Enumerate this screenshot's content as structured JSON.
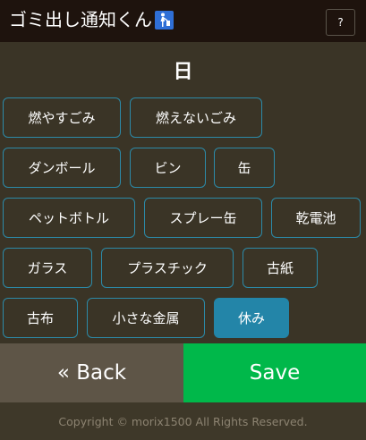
{
  "header": {
    "app_title": "ゴミ出し通知くん",
    "help_label": "?"
  },
  "day": {
    "title": "日"
  },
  "categories": [
    {
      "label": "燃やすごみ",
      "selected": false
    },
    {
      "label": "燃えないごみ",
      "selected": false
    },
    {
      "label": "ダンボール",
      "selected": false
    },
    {
      "label": "ビン",
      "selected": false
    },
    {
      "label": "缶",
      "selected": false
    },
    {
      "label": "ペットボトル",
      "selected": false
    },
    {
      "label": "スプレー缶",
      "selected": false
    },
    {
      "label": "乾電池",
      "selected": false
    },
    {
      "label": "ガラス",
      "selected": false
    },
    {
      "label": "プラスチック",
      "selected": false
    },
    {
      "label": "古紙",
      "selected": false
    },
    {
      "label": "古布",
      "selected": false
    },
    {
      "label": "小さな金属",
      "selected": false
    },
    {
      "label": "休み",
      "selected": true
    }
  ],
  "actions": {
    "back_label": "« Back",
    "save_label": "Save"
  },
  "footer": {
    "copyright": "Copyright © morix1500 All Rights Reserved."
  },
  "colors": {
    "background": "#3a3426",
    "header": "#1e130d",
    "chip_border": "#2c8aa8",
    "chip_active": "#2385a8",
    "save": "#00b84a",
    "back": "#5e5547"
  },
  "icons": {
    "title_icon": "person-trash-icon"
  }
}
